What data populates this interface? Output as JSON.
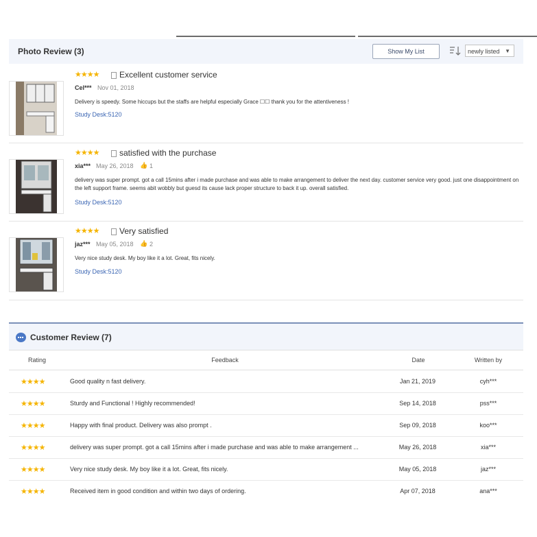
{
  "photo_review": {
    "title": "Photo Review (3)",
    "show_list_label": "Show My List",
    "sort_value": "newly listed",
    "items": [
      {
        "stars": "★★★★",
        "title": "Excellent customer service",
        "user": "Cel***",
        "date": "Nov 01, 2018",
        "likes": "",
        "text": "Delivery is speedy. Some hiccups but the staffs are helpful especially Grace ☐☐ thank you for the attentiveness !",
        "product": "Study Desk:5120"
      },
      {
        "stars": "★★★★",
        "title": "satisfied with the purchase",
        "user": "xia***",
        "date": "May 26, 2018",
        "likes": "1",
        "text": "delivery was super prompt. got a call 15mins after i made purchase and was able to make arrangement to deliver the next day. customer service very good. just one disappointment on the left support frame. seems abit wobbly but guesd its cause lack proper structure to back it up. overall satisfied.",
        "product": "Study Desk:5120"
      },
      {
        "stars": "★★★★",
        "title": "Very satisfied",
        "user": "jaz***",
        "date": "May 05, 2018",
        "likes": "2",
        "text": "Very nice study desk. My boy like it a lot. Great, fits nicely.",
        "product": "Study Desk:5120"
      }
    ]
  },
  "customer_review": {
    "title": "Customer Review (7)",
    "columns": [
      "Rating",
      "Feedback",
      "Date",
      "Written by"
    ],
    "rows": [
      {
        "stars": "★★★★",
        "feedback": "Good quality n fast delivery.",
        "date": "Jan 21, 2019",
        "author": "cyh***"
      },
      {
        "stars": "★★★★",
        "feedback": "Sturdy and Functional ! Highly recommended!",
        "date": "Sep 14, 2018",
        "author": "pss***"
      },
      {
        "stars": "★★★★",
        "feedback": "Happy with final product. Delivery was also prompt .",
        "date": "Sep 09, 2018",
        "author": "koo***"
      },
      {
        "stars": "★★★★",
        "feedback": "delivery was super prompt. got a call 15mins after i made purchase and was able to make arrangement ...",
        "date": "May 26, 2018",
        "author": "xia***"
      },
      {
        "stars": "★★★★",
        "feedback": "Very nice study desk. My boy like it a lot. Great, fits nicely.",
        "date": "May 05, 2018",
        "author": "jaz***"
      },
      {
        "stars": "★★★★",
        "feedback": "Received item in good condition and within two days of ordering.",
        "date": "Apr 07, 2018",
        "author": "ana***"
      }
    ]
  },
  "colors": {
    "star": "#f5b400",
    "link": "#3a65b3",
    "header_bg": "#f2f5fb"
  }
}
